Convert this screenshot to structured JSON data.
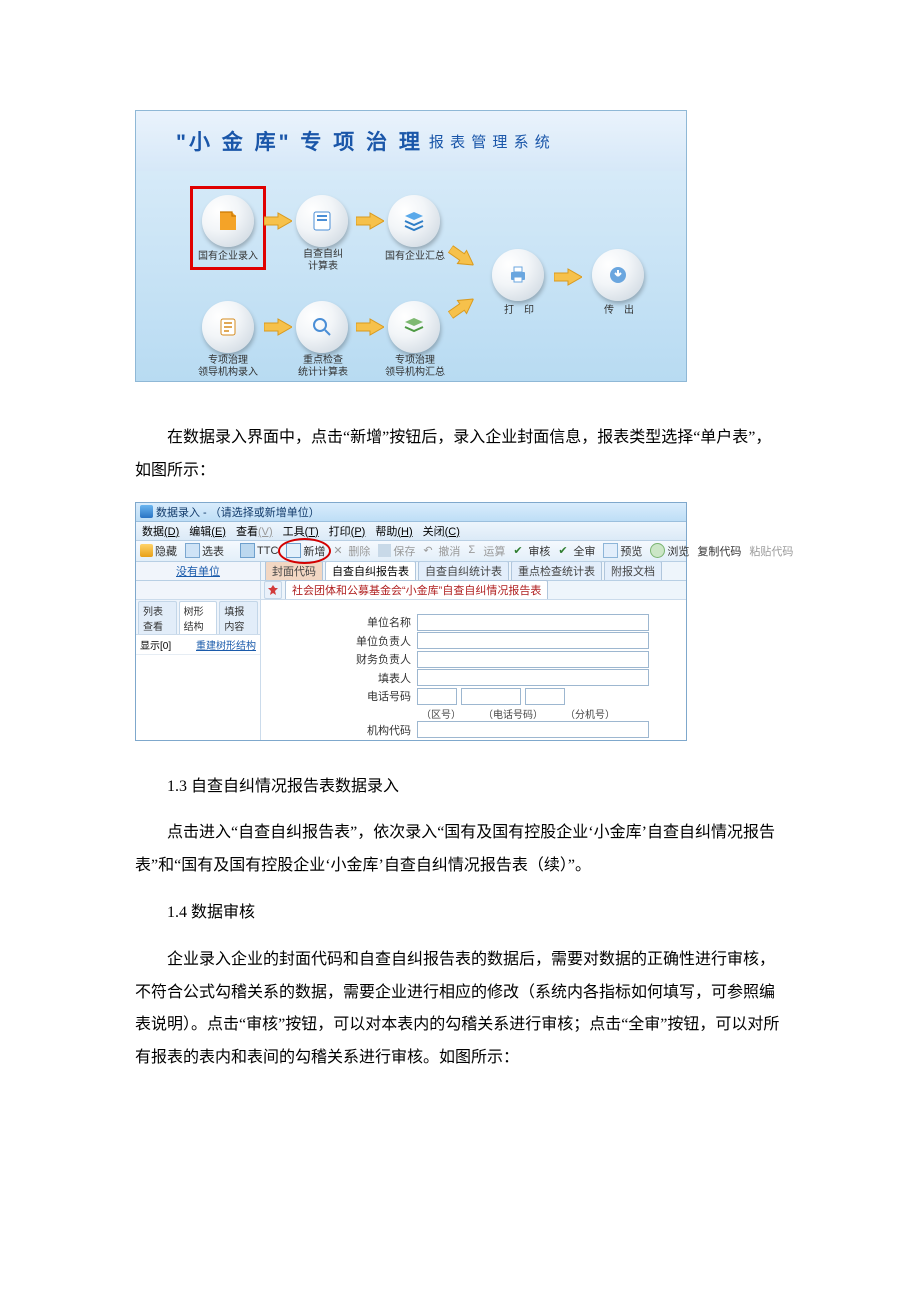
{
  "banner": {
    "big": "\"小 金 库\"  专 项 治 理",
    "small": "报 表 管 理 系 统"
  },
  "flow": {
    "n1": "国有企业录入",
    "n2a": "自查自纠",
    "n2b": "计算表",
    "n3": "国有企业汇总",
    "n4": "打　印",
    "n5": "传　出",
    "n6a": "专项治理",
    "n6b": "领导机构录入",
    "n7a": "重点检查",
    "n7b": "统计计算表",
    "n8a": "专项治理",
    "n8b": "领导机构汇总"
  },
  "para1": "在数据录入界面中，点击“新增”按钮后，录入企业封面信息，报表类型选择“单户表”，如图所示：",
  "shot2": {
    "title": "数据录入 - （请选择或新增单位）",
    "menu": {
      "m1": "数据",
      "m1k": "(D)",
      "m2": "编辑",
      "m2k": "(E)",
      "m3": "查看",
      "m3k": "(V)",
      "m4": "工具",
      "m4k": "(T)",
      "m5": "打印",
      "m5k": "(P)",
      "m6": "帮助",
      "m6k": "(H)",
      "m7": "关闭",
      "m7k": "(C)"
    },
    "tool": {
      "hide": "隐藏",
      "sel": "选表",
      "ttc": "TTC",
      "new": "新增",
      "del": "删除",
      "save": "保存",
      "undo": "撤消",
      "calc": "运算",
      "check": "审核",
      "all": "全审",
      "prev": "预览",
      "browse": "浏览",
      "copy": "复制代码",
      "paste": "粘贴代码"
    },
    "left_hint": "没有单位",
    "tabs": {
      "t1": "封面代码",
      "t2": "自查自纠报告表",
      "t3": "自查自纠统计表",
      "t4": "重点检查统计表",
      "t5": "附报文档"
    },
    "subtab": "社会团体和公募基金会“小金库”自查自纠情况报告表",
    "tree": {
      "t1": "列表查看",
      "t2": "树形结构",
      "t3": "填报内容",
      "row_l": "显示[0]",
      "row_r": "重建树形结构"
    },
    "form": {
      "f1": "单位名称",
      "f2": "单位负责人",
      "f3": "财务负责人",
      "f4": "填表人",
      "f5": "电话号码",
      "p1": "（区号）",
      "p2": "（电话号码）",
      "p3": "（分机号）",
      "f6": "机构代码"
    }
  },
  "h13": "1.3 自查自纠情况报告表数据录入",
  "para2": "点击进入“自查自纠报告表”，依次录入“国有及国有控股企业‘小金库’自查自纠情况报告表”和“国有及国有控股企业‘小金库’自查自纠情况报告表（续）”。",
  "h14": "1.4 数据审核",
  "para3": "企业录入企业的封面代码和自查自纠报告表的数据后，需要对数据的正确性进行审核，不符合公式勾稽关系的数据，需要企业进行相应的修改（系统内各指标如何填写，可参照编表说明）。点击“审核”按钮，可以对本表内的勾稽关系进行审核；点击“全审”按钮，可以对所有报表的表内和表间的勾稽关系进行审核。如图所示："
}
